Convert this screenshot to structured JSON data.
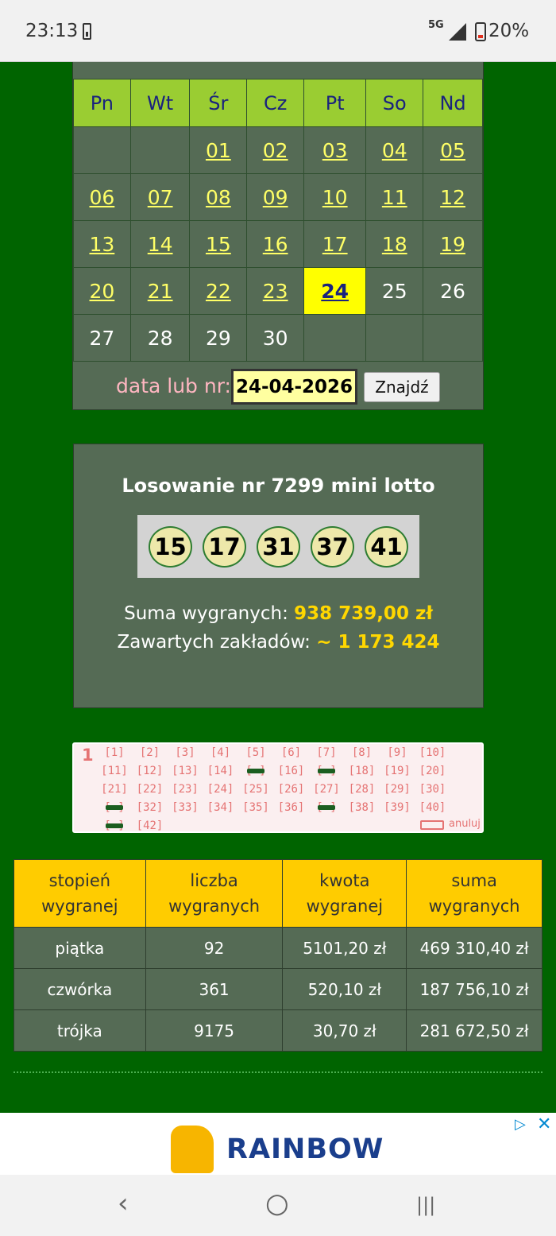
{
  "status_bar": {
    "time": "23:13",
    "network": "5G",
    "battery": "20%"
  },
  "calendar": {
    "weekdays": [
      "Pn",
      "Wt",
      "Śr",
      "Cz",
      "Pt",
      "So",
      "Nd"
    ],
    "weeks": [
      [
        "",
        "",
        "01",
        "02",
        "03",
        "04",
        "05"
      ],
      [
        "06",
        "07",
        "08",
        "09",
        "10",
        "11",
        "12"
      ],
      [
        "13",
        "14",
        "15",
        "16",
        "17",
        "18",
        "19"
      ],
      [
        "20",
        "21",
        "22",
        "23",
        "24",
        "25",
        "26"
      ],
      [
        "27",
        "28",
        "29",
        "30",
        "",
        "",
        ""
      ]
    ],
    "today": "24",
    "search_label": "data lub nr:",
    "date_value": "24-04-2026",
    "find_button": "Znajdź"
  },
  "draw": {
    "title": "Losowanie nr 7299 mini lotto",
    "numbers": [
      "15",
      "17",
      "31",
      "37",
      "41"
    ],
    "sum_label": "Suma wygranych:",
    "sum_value": "938 739,00 zł",
    "bets_label": "Zawartych zakładów:",
    "bets_value": "~ 1 173 424",
    "ball_color": "#eee8aa"
  },
  "coupon": {
    "number": "1",
    "marked": [
      15,
      17,
      31,
      37,
      41
    ],
    "cancel_label": "anuluj"
  },
  "prizes": {
    "headers": [
      "stopień wygranej",
      "liczba wygranych",
      "kwota wygranej",
      "suma wygranych"
    ],
    "rows": [
      [
        "piątka",
        "92",
        "5101,20 zł",
        "469 310,40 zł"
      ],
      [
        "czwórka",
        "361",
        "520,10 zł",
        "187 756,10 zł"
      ],
      [
        "trójka",
        "9175",
        "30,70 zł",
        "281 672,50 zł"
      ]
    ]
  },
  "ad": {
    "brand": "RAINBOW"
  },
  "nav": {
    "back": "‹",
    "home": "○",
    "recents": "|||"
  },
  "colors": {
    "page_bg": "#006400",
    "panel_bg": "#556b55",
    "header_bg": "#9acd32",
    "highlight": "#ffd700",
    "table_header": "#ffcc00"
  }
}
